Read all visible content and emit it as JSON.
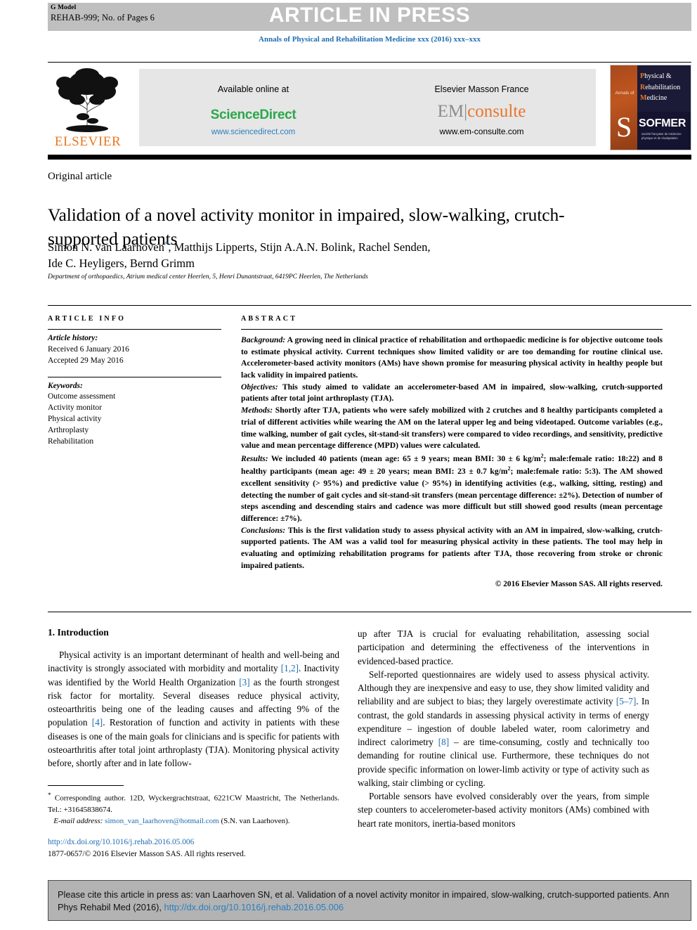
{
  "banner": {
    "gmodel_label": "G Model",
    "gmodel_id": "REHAB-999; No. of Pages 6",
    "article_in_press": "ARTICLE IN PRESS"
  },
  "journal_line": "Annals of Physical and Rehabilitation Medicine xxx (2016) xxx–xxx",
  "masthead": {
    "elsevier_word": "ELSEVIER",
    "available_online": "Available online at",
    "sciencedirect": "ScienceDirect",
    "sciencedirect_url": "www.sciencedirect.com",
    "elsevier_masson": "Elsevier Masson France",
    "em_part": "EM",
    "consulte_part": "consulte",
    "emconsulte_url": "www.em-consulte.com",
    "sofmer": {
      "annals_of": "Annals of",
      "line1_cap": "P",
      "line1_rest": "hysical &",
      "line2_cap": "R",
      "line2_rest": "ehabilitation",
      "line3_cap": "M",
      "line3_rest": "edicine",
      "brand": "SOFMER",
      "subtitle": "société française de médecine physique et de réadaptation"
    }
  },
  "article": {
    "type": "Original article",
    "title": "Validation of a novel activity monitor in impaired, slow-walking, crutch-supported patients",
    "authors_line1": "Simon N. van Laarhoven",
    "authors_star": "*",
    "authors_line1_rest": ", Matthijs Lipperts, Stijn A.A.N. Bolink, Rachel Senden,",
    "authors_line2": "Ide C. Heyligers, Bernd Grimm",
    "affiliation": "Department of orthopaedics, Atrium medical center Heerlen, 5, Henri Dunantstraat, 6419PC Heerlen, The Netherlands"
  },
  "info": {
    "heading": "ARTICLE INFO",
    "history_label": "Article history:",
    "received": "Received 6 January 2016",
    "accepted": "Accepted 29 May 2016",
    "keywords_label": "Keywords:",
    "keywords": [
      "Outcome assessment",
      "Activity monitor",
      "Physical activity",
      "Arthroplasty",
      "Rehabilitation"
    ]
  },
  "abstract": {
    "heading": "ABSTRACT",
    "background_label": "Background:",
    "background_text": " A growing need in clinical practice of rehabilitation and orthopaedic medicine is for objective outcome tools to estimate physical activity. Current techniques show limited validity or are too demanding for routine clinical use. Accelerometer-based activity monitors (AMs) have shown promise for measuring physical activity in healthy people but lack validity in impaired patients.",
    "objectives_label": "Objectives:",
    "objectives_text": " This study aimed to validate an accelerometer-based AM in impaired, slow-walking, crutch-supported patients after total joint arthroplasty (TJA).",
    "methods_label": "Methods:",
    "methods_text": " Shortly after TJA, patients who were safely mobilized with 2 crutches and 8 healthy participants completed a trial of different activities while wearing the AM on the lateral upper leg and being videotaped. Outcome variables (e.g., time walking, number of gait cycles, sit-stand-sit transfers) were compared to video recordings, and sensitivity, predictive value and mean percentage difference (MPD) values were calculated.",
    "results_label": "Results:",
    "results_text_a": " We included 40 patients (mean age: 65 ± 9 years; mean BMI: 30 ± 6 kg/m",
    "results_sup1": "2",
    "results_text_b": "; male:female ratio: 18:22) and 8 healthy participants (mean age: 49 ± 20 years; mean BMI: 23 ± 0.7 kg/m",
    "results_sup2": "2",
    "results_text_c": "; male:female ratio: 5:3). The AM showed excellent sensitivity (> 95%) and predictive value (> 95%) in identifying activities (e.g., walking, sitting, resting) and detecting the number of gait cycles and sit-stand-sit transfers (mean percentage difference: ±2%). Detection of number of steps ascending and descending stairs and cadence was more difficult but still showed good results (mean percentage difference: ±7%).",
    "conclusions_label": "Conclusions:",
    "conclusions_text": " This is the first validation study to assess physical activity with an AM in impaired, slow-walking, crutch-supported patients. The AM was a valid tool for measuring physical activity in these patients. The tool may help in evaluating and optimizing rehabilitation programs for patients after TJA, those recovering from stroke or chronic impaired patients.",
    "copyright": "© 2016 Elsevier Masson SAS. All rights reserved."
  },
  "introduction": {
    "heading": "1. Introduction",
    "p1_a": "Physical activity is an important determinant of health and well-being and inactivity is strongly associated with morbidity and mortality ",
    "p1_ref1": "[1,2]",
    "p1_b": ". Inactivity was identified by the World Health Organization ",
    "p1_ref2": "[3]",
    "p1_c": " as the fourth strongest risk factor for mortality. Several diseases reduce physical activity, osteoarthritis being one of the leading causes and affecting 9% of the population ",
    "p1_ref3": "[4]",
    "p1_d": ". Restoration of function and activity in patients with these diseases is one of the main goals for clinicians and is specific for patients with osteoarthritis after total joint arthroplasty (TJA). Monitoring physical activity before, shortly after and in late follow-",
    "p2_a": "up after TJA is crucial for evaluating rehabilitation, assessing social participation and determining the effectiveness of the interventions in evidenced-based practice.",
    "p3_a": "Self-reported questionnaires are widely used to assess physical activity. Although they are inexpensive and easy to use, they show limited validity and reliability and are subject to bias; they largely overestimate activity ",
    "p3_ref1": "[5–7]",
    "p3_b": ". In contrast, the gold standards in assessing physical activity in terms of energy expenditure – ingestion of double labeled water, room calorimetry and indirect calorimetry ",
    "p3_ref2": "[8]",
    "p3_c": " – are time-consuming, costly and technically too demanding for routine clinical use. Furthermore, these techniques do not provide specific information on lower-limb activity or type of activity such as walking, stair climbing or cycling.",
    "p4_a": "Portable sensors have evolved considerably over the years, from simple step counters to accelerometer-based activity monitors (AMs) combined with heart rate monitors, inertia-based monitors"
  },
  "footnote": {
    "star": "*",
    "corresponding": " Corresponding author. 12D, Wyckergrachtstraat, 6221CW Maastricht, The Netherlands. Tel.: +31645838674.",
    "email_label": "E-mail address:",
    "email": "simon_van_laarhoven@hotmail.com",
    "email_attrib": " (S.N. van Laarhoven)."
  },
  "doi_block": {
    "doi_url": "http://dx.doi.org/10.1016/j.rehab.2016.05.006",
    "issn_copyright": "1877-0657/© 2016 Elsevier Masson SAS. All rights reserved."
  },
  "cite_box": {
    "text_a": "Please cite this article in press as: van Laarhoven SN, et al. Validation of a novel activity monitor in impaired, slow-walking, crutch-supported patients. Ann Phys Rehabil Med (2016), ",
    "link": "http://dx.doi.org/10.1016/j.rehab.2016.05.006"
  },
  "colors": {
    "link_blue": "#1f6cb0",
    "elsevier_orange": "#e87722",
    "sciencedirect_green": "#2aa84a",
    "banner_grey": "#bfbfbf",
    "cite_grey": "#b3b3b3"
  }
}
